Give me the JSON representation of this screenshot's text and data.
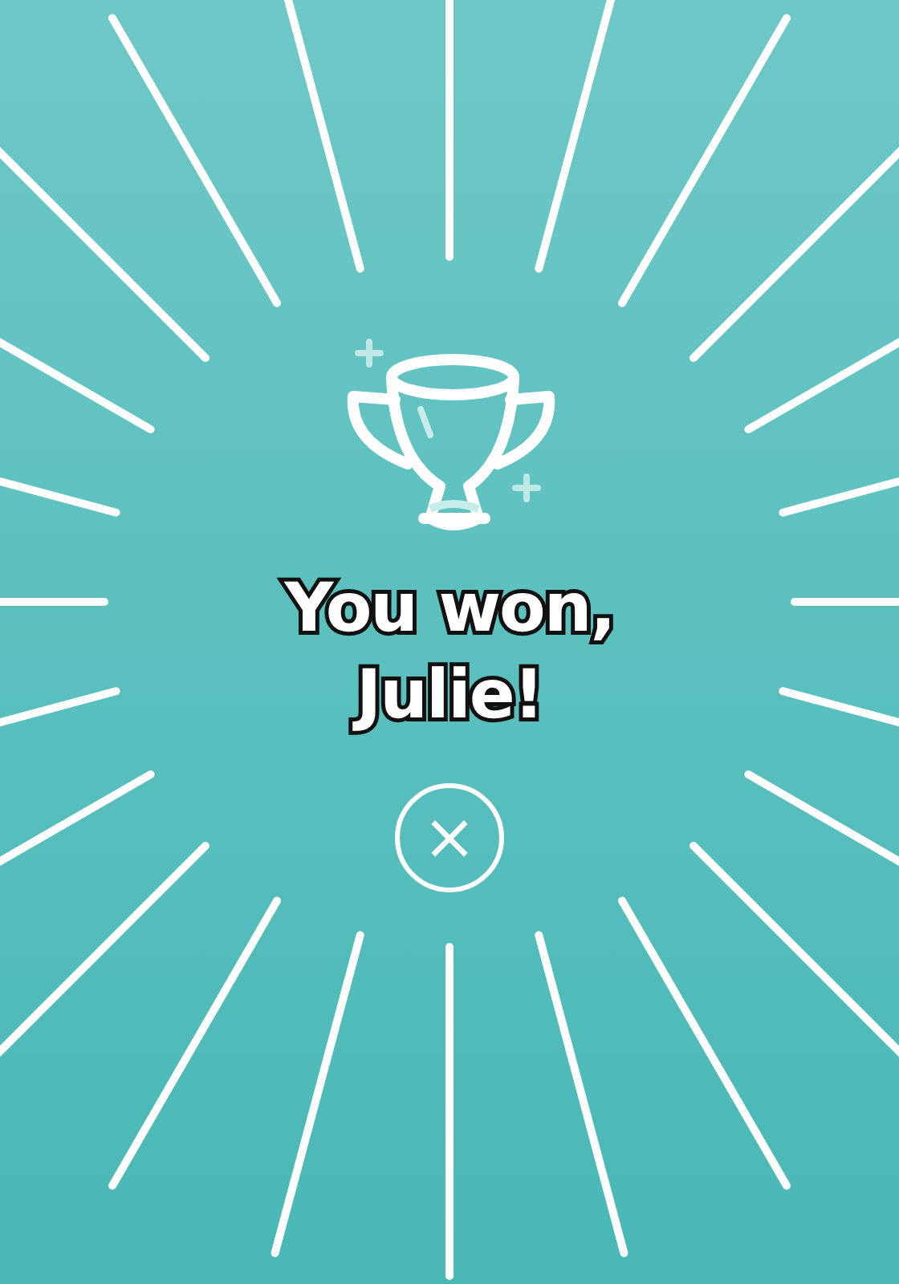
{
  "message": "You won, Julie!",
  "close_button": {
    "label": "×"
  }
}
